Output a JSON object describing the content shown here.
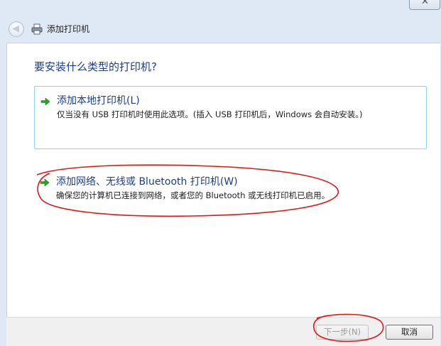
{
  "window": {
    "title": "添加打印机",
    "close_glyph": "✕"
  },
  "header": {
    "back_icon": "back-arrow-icon",
    "printer_icon": "printer-icon"
  },
  "main": {
    "question": "要安装什么类型的打印机?",
    "options": [
      {
        "title": "添加本地打印机(L)",
        "description": "仅当没有 USB 打印机时使用此选项。(插入 USB 打印机后，Windows 会自动安装。)"
      },
      {
        "title": "添加网络、无线或 Bluetooth 打印机(W)",
        "description": "确保您的计算机已连接到网络，或者您的 Bluetooth 或无线打印机已启用。"
      }
    ]
  },
  "footer": {
    "next_label": "下一步(N)",
    "cancel_label": "取消"
  },
  "colors": {
    "link_blue": "#1b3e8c",
    "annotation_red": "#e01818",
    "arrow_green": "#2aa12a",
    "selection_border": "#8fd3e8"
  }
}
